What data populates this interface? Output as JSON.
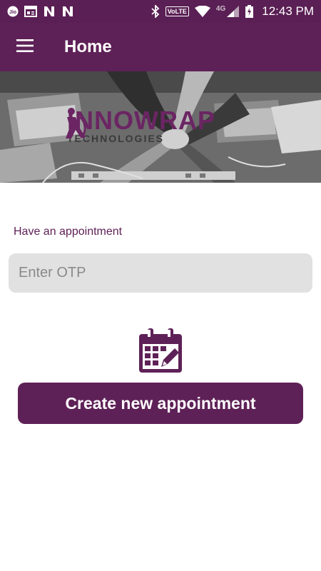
{
  "status_bar": {
    "time": "12:43 PM",
    "volte_label": "VoLTE",
    "network_label": "4G",
    "left_icons": [
      "jio-icon",
      "news-icon",
      "n-notification-icon",
      "n-notification-icon"
    ],
    "right_icons": [
      "bluetooth-icon",
      "volte-icon",
      "wifi-icon",
      "signal-icon",
      "battery-icon"
    ]
  },
  "app_bar": {
    "title": "Home",
    "menu_icon": "hamburger-menu-icon"
  },
  "banner": {
    "brand_name": "INNOWRAP",
    "brand_sub": "TECHNOLOGIES"
  },
  "appointment": {
    "label": "Have an appointment",
    "otp_placeholder": "Enter OTP",
    "otp_value": "",
    "calendar_icon": "calendar-icon",
    "create_button_label": "Create new appointment"
  },
  "colors": {
    "primary": "#5e2157",
    "status_bar": "#5a1f54",
    "input_bg": "#e1e1e1"
  }
}
